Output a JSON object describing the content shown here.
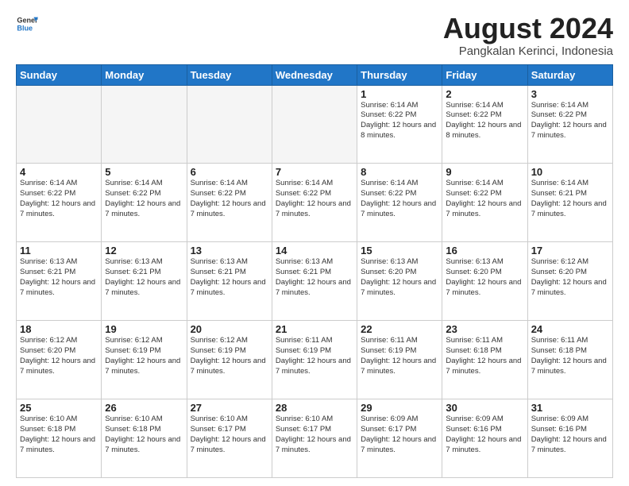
{
  "header": {
    "logo_line1": "General",
    "logo_line2": "Blue",
    "title": "August 2024",
    "subtitle": "Pangkalan Kerinci, Indonesia"
  },
  "days_of_week": [
    "Sunday",
    "Monday",
    "Tuesday",
    "Wednesday",
    "Thursday",
    "Friday",
    "Saturday"
  ],
  "weeks": [
    [
      {
        "day": "",
        "empty": true
      },
      {
        "day": "",
        "empty": true
      },
      {
        "day": "",
        "empty": true
      },
      {
        "day": "",
        "empty": true
      },
      {
        "day": "1",
        "sunrise": "6:14 AM",
        "sunset": "6:22 PM",
        "daylight": "12 hours and 8 minutes."
      },
      {
        "day": "2",
        "sunrise": "6:14 AM",
        "sunset": "6:22 PM",
        "daylight": "12 hours and 8 minutes."
      },
      {
        "day": "3",
        "sunrise": "6:14 AM",
        "sunset": "6:22 PM",
        "daylight": "12 hours and 7 minutes."
      }
    ],
    [
      {
        "day": "4",
        "sunrise": "6:14 AM",
        "sunset": "6:22 PM",
        "daylight": "12 hours and 7 minutes."
      },
      {
        "day": "5",
        "sunrise": "6:14 AM",
        "sunset": "6:22 PM",
        "daylight": "12 hours and 7 minutes."
      },
      {
        "day": "6",
        "sunrise": "6:14 AM",
        "sunset": "6:22 PM",
        "daylight": "12 hours and 7 minutes."
      },
      {
        "day": "7",
        "sunrise": "6:14 AM",
        "sunset": "6:22 PM",
        "daylight": "12 hours and 7 minutes."
      },
      {
        "day": "8",
        "sunrise": "6:14 AM",
        "sunset": "6:22 PM",
        "daylight": "12 hours and 7 minutes."
      },
      {
        "day": "9",
        "sunrise": "6:14 AM",
        "sunset": "6:22 PM",
        "daylight": "12 hours and 7 minutes."
      },
      {
        "day": "10",
        "sunrise": "6:14 AM",
        "sunset": "6:21 PM",
        "daylight": "12 hours and 7 minutes."
      }
    ],
    [
      {
        "day": "11",
        "sunrise": "6:13 AM",
        "sunset": "6:21 PM",
        "daylight": "12 hours and 7 minutes."
      },
      {
        "day": "12",
        "sunrise": "6:13 AM",
        "sunset": "6:21 PM",
        "daylight": "12 hours and 7 minutes."
      },
      {
        "day": "13",
        "sunrise": "6:13 AM",
        "sunset": "6:21 PM",
        "daylight": "12 hours and 7 minutes."
      },
      {
        "day": "14",
        "sunrise": "6:13 AM",
        "sunset": "6:21 PM",
        "daylight": "12 hours and 7 minutes."
      },
      {
        "day": "15",
        "sunrise": "6:13 AM",
        "sunset": "6:20 PM",
        "daylight": "12 hours and 7 minutes."
      },
      {
        "day": "16",
        "sunrise": "6:13 AM",
        "sunset": "6:20 PM",
        "daylight": "12 hours and 7 minutes."
      },
      {
        "day": "17",
        "sunrise": "6:12 AM",
        "sunset": "6:20 PM",
        "daylight": "12 hours and 7 minutes."
      }
    ],
    [
      {
        "day": "18",
        "sunrise": "6:12 AM",
        "sunset": "6:20 PM",
        "daylight": "12 hours and 7 minutes."
      },
      {
        "day": "19",
        "sunrise": "6:12 AM",
        "sunset": "6:19 PM",
        "daylight": "12 hours and 7 minutes."
      },
      {
        "day": "20",
        "sunrise": "6:12 AM",
        "sunset": "6:19 PM",
        "daylight": "12 hours and 7 minutes."
      },
      {
        "day": "21",
        "sunrise": "6:11 AM",
        "sunset": "6:19 PM",
        "daylight": "12 hours and 7 minutes."
      },
      {
        "day": "22",
        "sunrise": "6:11 AM",
        "sunset": "6:19 PM",
        "daylight": "12 hours and 7 minutes."
      },
      {
        "day": "23",
        "sunrise": "6:11 AM",
        "sunset": "6:18 PM",
        "daylight": "12 hours and 7 minutes."
      },
      {
        "day": "24",
        "sunrise": "6:11 AM",
        "sunset": "6:18 PM",
        "daylight": "12 hours and 7 minutes."
      }
    ],
    [
      {
        "day": "25",
        "sunrise": "6:10 AM",
        "sunset": "6:18 PM",
        "daylight": "12 hours and 7 minutes."
      },
      {
        "day": "26",
        "sunrise": "6:10 AM",
        "sunset": "6:18 PM",
        "daylight": "12 hours and 7 minutes."
      },
      {
        "day": "27",
        "sunrise": "6:10 AM",
        "sunset": "6:17 PM",
        "daylight": "12 hours and 7 minutes."
      },
      {
        "day": "28",
        "sunrise": "6:10 AM",
        "sunset": "6:17 PM",
        "daylight": "12 hours and 7 minutes."
      },
      {
        "day": "29",
        "sunrise": "6:09 AM",
        "sunset": "6:17 PM",
        "daylight": "12 hours and 7 minutes."
      },
      {
        "day": "30",
        "sunrise": "6:09 AM",
        "sunset": "6:16 PM",
        "daylight": "12 hours and 7 minutes."
      },
      {
        "day": "31",
        "sunrise": "6:09 AM",
        "sunset": "6:16 PM",
        "daylight": "12 hours and 7 minutes."
      }
    ]
  ],
  "labels": {
    "sunrise_prefix": "Sunrise: ",
    "sunset_prefix": "Sunset: ",
    "daylight_prefix": "Daylight: "
  }
}
